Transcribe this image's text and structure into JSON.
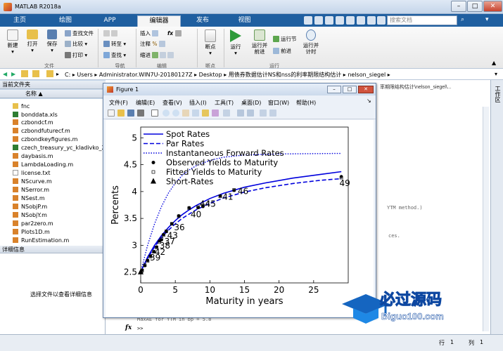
{
  "window": {
    "title": "MATLAB R2018a"
  },
  "tabs": [
    "主页",
    "绘图",
    "APP",
    "编辑器",
    "发布",
    "视图"
  ],
  "search_placeholder": "搜索文档",
  "ribbon": {
    "new": "新建",
    "open": "打开",
    "save": "保存",
    "find_files": "查找文件",
    "compare": "比较",
    "print": "打印",
    "goto": "转至",
    "find": "查找",
    "insert": "插入",
    "fx": "fx",
    "comment": "注释",
    "indent": "缩进",
    "breakpoints": "断点",
    "run": "运行",
    "run_advance": "运行并\n前进",
    "run_section": "运行节",
    "advance": "前进",
    "run_time": "运行并\n计时",
    "group_file": "文件",
    "group_nav": "导航",
    "group_edit": "编辑",
    "group_bp": "断点",
    "group_run": "运行"
  },
  "address": {
    "parts": [
      "C:",
      "Users",
      "Administrator.WIN7U-20180127Z",
      "Desktop",
      "用债券数据估计NS和nss的利率期限结构估计",
      "nelson_siegel"
    ],
    "right_text": "率期限结构估计\\nelson_siegel\\..."
  },
  "current_folder": {
    "header": "当前文件夹",
    "name_col": "名称 ▲",
    "files": [
      "fnc",
      "bonddata.xls",
      "czbondcf.m",
      "czbondfuturecf.m",
      "czbondkeyfigures.m",
      "czech_treasury_yc_kladivko_2",
      "daybasis.m",
      "LambdaLoading.m",
      "license.txt",
      "NScurve.m",
      "NSerror.m",
      "NSest.m",
      "NSobjP.m",
      "NSobjY.m",
      "par2zero.m",
      "Plots1D.m",
      "RunEstimation.m"
    ]
  },
  "details": {
    "header": "详细信息",
    "empty_text": "选择文件以查看详细信息"
  },
  "command_window": {
    "line1": "MaxAE for YTM in bp = 5.8",
    "prompt": ">>",
    "snippet_a": "YTM method.)",
    "snippet_b": "ces.",
    "fx": "fx"
  },
  "right_strip": {
    "label": "工作区"
  },
  "status": {
    "row_label": "行",
    "row": "1",
    "col_label": "列",
    "col": "1"
  },
  "figure": {
    "title": "Figure 1",
    "menu": [
      "文件(F)",
      "编辑(E)",
      "查看(V)",
      "插入(I)",
      "工具(T)",
      "桌面(D)",
      "窗口(W)",
      "帮助(H)"
    ]
  },
  "chart_data": {
    "type": "line",
    "title": "",
    "xlabel": "Maturity in years",
    "ylabel": "Percents",
    "xlim": [
      0,
      30
    ],
    "ylim": [
      2.3,
      5.2
    ],
    "xticks": [
      0,
      5,
      10,
      15,
      20,
      25
    ],
    "yticks": [
      2.5,
      3,
      3.5,
      4,
      4.5,
      5
    ],
    "legend": [
      "Spot Rates",
      "Par Rates",
      "Instantaneous Forward Rates",
      "Observed Yields to Maturity",
      "Fitted Yields to Maturity",
      "Short-Rates"
    ],
    "legend_position": "top-left",
    "spot_rates": [
      [
        0,
        2.5
      ],
      [
        1,
        2.78
      ],
      [
        2,
        3.0
      ],
      [
        3,
        3.18
      ],
      [
        4,
        3.33
      ],
      [
        5,
        3.46
      ],
      [
        6,
        3.57
      ],
      [
        7,
        3.66
      ],
      [
        8,
        3.74
      ],
      [
        10,
        3.87
      ],
      [
        12,
        3.97
      ],
      [
        15,
        4.08
      ],
      [
        18,
        4.16
      ],
      [
        22,
        4.25
      ],
      [
        26,
        4.32
      ],
      [
        29,
        4.37
      ]
    ],
    "par_rates": [
      [
        0,
        2.5
      ],
      [
        1,
        2.76
      ],
      [
        2,
        2.97
      ],
      [
        3,
        3.14
      ],
      [
        4,
        3.28
      ],
      [
        5,
        3.4
      ],
      [
        6,
        3.5
      ],
      [
        7,
        3.58
      ],
      [
        8,
        3.66
      ],
      [
        10,
        3.78
      ],
      [
        12,
        3.88
      ],
      [
        15,
        3.99
      ],
      [
        18,
        4.07
      ],
      [
        22,
        4.15
      ],
      [
        26,
        4.21
      ],
      [
        29,
        4.24
      ]
    ],
    "forward_rates": [
      [
        0,
        2.5
      ],
      [
        1,
        3.0
      ],
      [
        2,
        3.4
      ],
      [
        3,
        3.72
      ],
      [
        4,
        3.97
      ],
      [
        5,
        4.16
      ],
      [
        6,
        4.3
      ],
      [
        7,
        4.4
      ],
      [
        8,
        4.48
      ],
      [
        10,
        4.58
      ],
      [
        12,
        4.64
      ],
      [
        15,
        4.68
      ],
      [
        20,
        4.7
      ],
      [
        29,
        4.71
      ]
    ],
    "observed_ytm": [
      [
        0.2,
        2.54
      ],
      [
        0.6,
        2.62
      ],
      [
        1.0,
        2.72
      ],
      [
        1.4,
        2.8
      ],
      [
        1.9,
        2.88
      ],
      [
        2.3,
        2.97
      ],
      [
        2.7,
        3.08
      ],
      [
        3.0,
        3.1
      ],
      [
        3.3,
        3.2
      ],
      [
        3.7,
        3.26
      ],
      [
        4.5,
        3.4
      ],
      [
        5.5,
        3.55
      ],
      [
        7.0,
        3.7
      ],
      [
        8.3,
        3.7
      ],
      [
        9.0,
        3.72
      ],
      [
        11.5,
        3.92
      ],
      [
        13.5,
        4.02
      ],
      [
        29,
        4.28
      ]
    ],
    "fitted_ytm": [
      [
        0.2,
        2.53
      ],
      [
        0.6,
        2.63
      ],
      [
        1.0,
        2.71
      ],
      [
        1.4,
        2.79
      ],
      [
        1.9,
        2.88
      ],
      [
        2.3,
        2.96
      ],
      [
        2.7,
        3.06
      ],
      [
        3.0,
        3.12
      ],
      [
        3.3,
        3.19
      ],
      [
        3.7,
        3.26
      ],
      [
        4.5,
        3.4
      ],
      [
        5.5,
        3.54
      ],
      [
        7.0,
        3.69
      ],
      [
        8.3,
        3.71
      ],
      [
        9.0,
        3.74
      ],
      [
        11.5,
        3.91
      ],
      [
        13.5,
        4.03
      ],
      [
        29,
        4.26
      ]
    ],
    "short_rates": [
      [
        0,
        2.5
      ]
    ],
    "point_labels": [
      {
        "x": 2.1,
        "y": 2.72,
        "text": "39"
      },
      {
        "x": 2.8,
        "y": 2.82,
        "text": "42"
      },
      {
        "x": 3.5,
        "y": 2.94,
        "text": "38"
      },
      {
        "x": 4.2,
        "y": 3.02,
        "text": "37"
      },
      {
        "x": 4.6,
        "y": 3.13,
        "text": "43"
      },
      {
        "x": 5.6,
        "y": 3.28,
        "text": "36"
      },
      {
        "x": 8.0,
        "y": 3.52,
        "text": "40"
      },
      {
        "x": 9.3,
        "y": 3.72,
        "text": "44"
      },
      {
        "x": 10.1,
        "y": 3.72,
        "text": "45"
      },
      {
        "x": 12.6,
        "y": 3.85,
        "text": "41"
      },
      {
        "x": 14.8,
        "y": 3.95,
        "text": "46"
      },
      {
        "x": 29.5,
        "y": 4.1,
        "text": "49"
      }
    ]
  },
  "watermark": {
    "brand": "必过源码",
    "site": "Biguo100.com"
  }
}
